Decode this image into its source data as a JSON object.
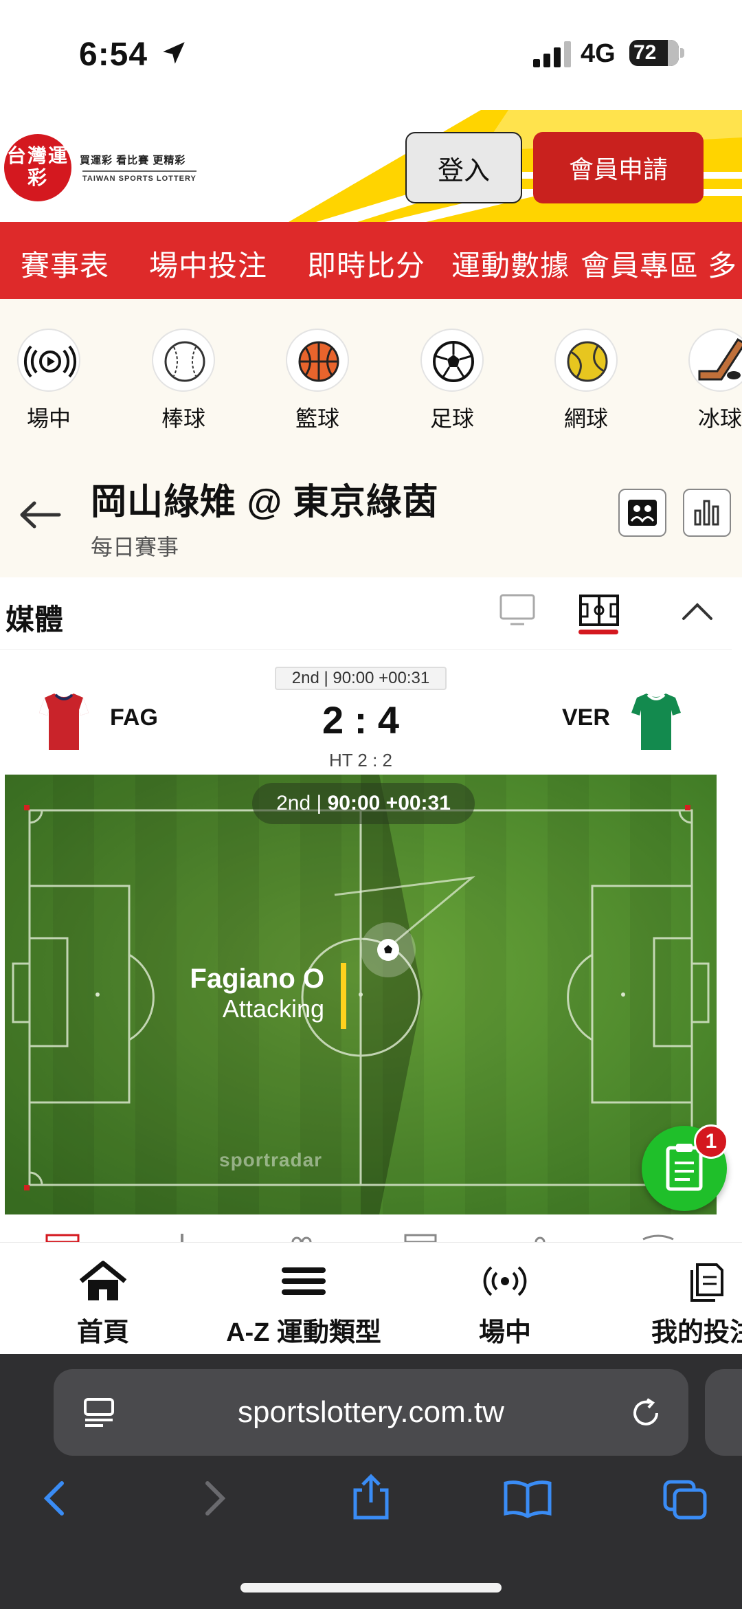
{
  "status_bar": {
    "time": "6:54",
    "network": "4G",
    "battery": "72"
  },
  "header": {
    "logo_text": "台灣運彩",
    "logo_slogan": "買運彩 看比賽 更精彩",
    "logo_sub": "TAIWAN SPORTS LOTTERY",
    "login_label": "登入",
    "register_label": "會員申請",
    "accent_color": "#de2a2a"
  },
  "main_nav": [
    "賽事表",
    "場中投注",
    "即時比分",
    "運動數據",
    "會員專區",
    "多"
  ],
  "sports": [
    {
      "label": "場中",
      "icon": "live-broadcast-icon"
    },
    {
      "label": "棒球",
      "icon": "baseball-icon"
    },
    {
      "label": "籃球",
      "icon": "basketball-icon"
    },
    {
      "label": "足球",
      "icon": "soccer-ball-icon"
    },
    {
      "label": "網球",
      "icon": "tennis-ball-icon"
    },
    {
      "label": "冰球",
      "icon": "ice-hockey-icon"
    }
  ],
  "match": {
    "title": "岡山綠雉 @ 東京綠茵",
    "subtitle": "每日賽事"
  },
  "media": {
    "title": "媒體"
  },
  "scoreboard": {
    "period": "2nd | 90:00 +00:31",
    "home": "FAG",
    "away": "VER",
    "score": "2 : 4",
    "halftime": "HT 2 : 2"
  },
  "pitch": {
    "period": "2nd",
    "clock": "90:00 +00:31",
    "team": "Fagiano O",
    "state": "Attacking",
    "watermark": "sportradar"
  },
  "fab": {
    "badge": "1"
  },
  "bottom_nav": [
    {
      "label": "首頁",
      "icon": "home-icon"
    },
    {
      "label": "A-Z 運動類型",
      "icon": "menu-icon"
    },
    {
      "label": "場中",
      "icon": "live-icon"
    },
    {
      "label": "我的投注",
      "icon": "my-bets-icon"
    }
  ],
  "browser": {
    "url": "sportslottery.com.tw"
  }
}
